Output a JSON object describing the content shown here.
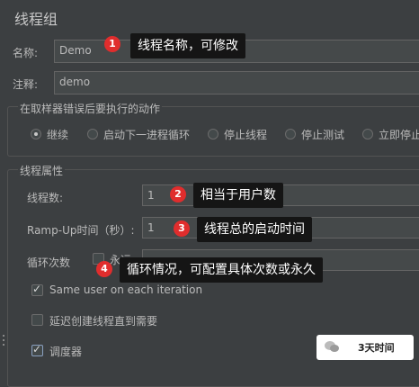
{
  "thread_group": {
    "title": "线程组",
    "name_label": "名称:",
    "name_value": "Demo",
    "comment_label": "注释:",
    "comment_value": "demo"
  },
  "error_action": {
    "title": "在取样器错误后要执行的动作",
    "options": [
      "继续",
      "启动下一进程循环",
      "停止线程",
      "停止测试",
      "立即停止"
    ],
    "selected": "继续"
  },
  "thread_props": {
    "title": "线程属性",
    "threads_label": "线程数:",
    "threads_value": "1",
    "rampup_label": "Ramp-Up时间（秒）:",
    "rampup_value": "1",
    "loop_label": "循环次数",
    "forever_label": "永远",
    "same_user_label": "Same user on each iteration",
    "same_user_checked": true,
    "delay_label": "延迟创建线程直到需要",
    "delay_checked": false,
    "scheduler_label": "调度器",
    "scheduler_checked": true
  },
  "annotations": [
    {
      "num": "1",
      "text": "线程名称，可修改"
    },
    {
      "num": "2",
      "text": "相当于用户数"
    },
    {
      "num": "3",
      "text": "线程总的启动时间"
    },
    {
      "num": "4",
      "text": "循环情况，可配置具体次数或永久"
    }
  ],
  "watermark": {
    "text": "3天时间"
  },
  "colors": {
    "background": "#3c3f41",
    "badge": "#e02d2d",
    "tooltip": "#151515"
  }
}
